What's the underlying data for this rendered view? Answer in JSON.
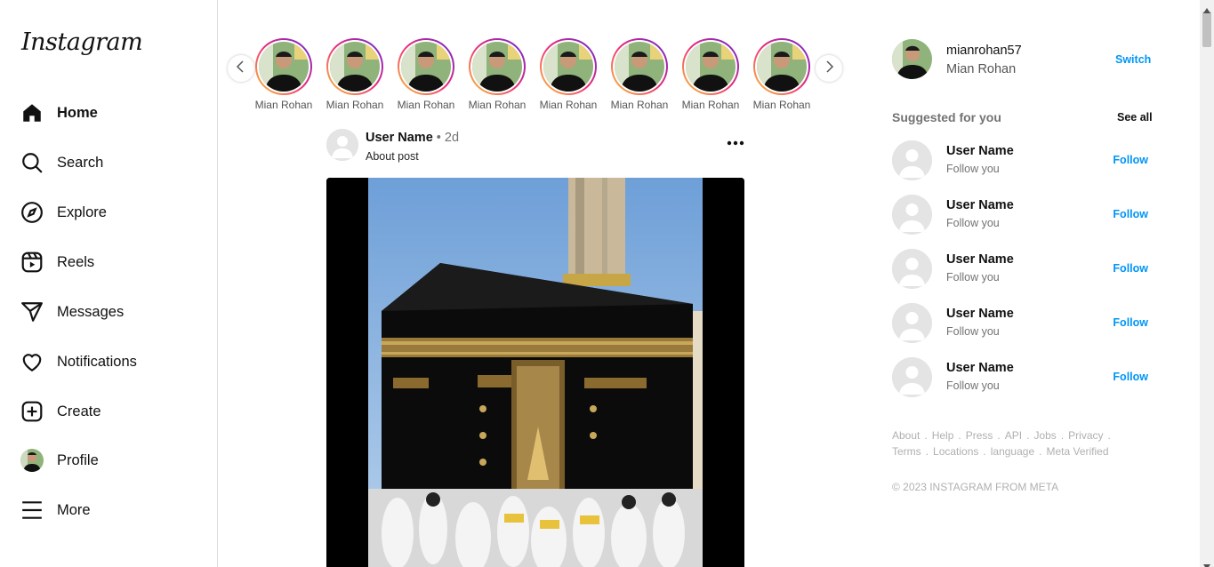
{
  "app": {
    "logo_text": "Instagram"
  },
  "sidebar": {
    "items": [
      {
        "label": "Home",
        "icon": "home-icon",
        "active": true
      },
      {
        "label": "Search",
        "icon": "search-icon"
      },
      {
        "label": "Explore",
        "icon": "compass-icon"
      },
      {
        "label": "Reels",
        "icon": "reels-icon"
      },
      {
        "label": "Messages",
        "icon": "send-icon"
      },
      {
        "label": "Notifications",
        "icon": "heart-icon"
      },
      {
        "label": "Create",
        "icon": "plus-square-icon"
      },
      {
        "label": "Profile",
        "icon": "avatar"
      },
      {
        "label": "More",
        "icon": "menu-icon"
      }
    ]
  },
  "stories": {
    "items": [
      {
        "name": "Mian Rohan"
      },
      {
        "name": "Mian Rohan"
      },
      {
        "name": "Mian Rohan"
      },
      {
        "name": "Mian Rohan"
      },
      {
        "name": "Mian Rohan"
      },
      {
        "name": "Mian Rohan"
      },
      {
        "name": "Mian Rohan"
      },
      {
        "name": "Mian Rohan"
      }
    ]
  },
  "post": {
    "username": "User Name",
    "time": " • 2d",
    "caption": "About post"
  },
  "current_user": {
    "username": "mianrohan57",
    "full_name": "Mian Rohan",
    "switch_label": "Switch"
  },
  "suggestions": {
    "title": "Suggested for you",
    "see_all": "See all",
    "items": [
      {
        "username": "User Name",
        "subtitle": "Follow you",
        "action": "Follow"
      },
      {
        "username": "User Name",
        "subtitle": "Follow you",
        "action": "Follow"
      },
      {
        "username": "User Name",
        "subtitle": "Follow you",
        "action": "Follow"
      },
      {
        "username": "User Name",
        "subtitle": "Follow you",
        "action": "Follow"
      },
      {
        "username": "User Name",
        "subtitle": "Follow you",
        "action": "Follow"
      }
    ]
  },
  "footer": {
    "links": [
      "About",
      "Help",
      "Press",
      "API",
      "Jobs",
      "Privacy",
      "Terms",
      "Locations",
      "language",
      "Meta Verified"
    ],
    "copyright": "© 2023 INSTAGRAM FROM META"
  },
  "colors": {
    "accent": "#0095f6",
    "border": "#dbdbdb",
    "muted": "#737373"
  }
}
